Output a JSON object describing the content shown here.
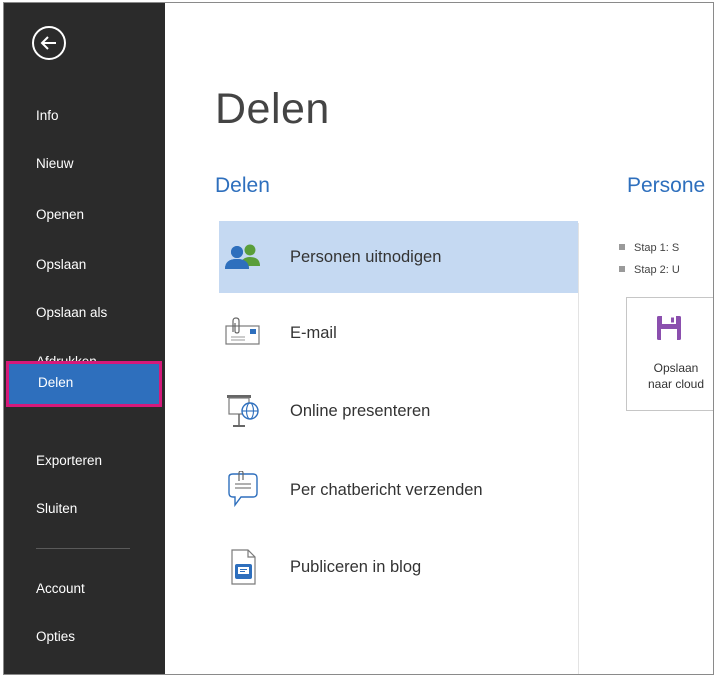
{
  "sidebar": {
    "back_icon": "back-arrow-icon",
    "items": [
      {
        "id": "info",
        "label": "Info"
      },
      {
        "id": "nieuw",
        "label": "Nieuw"
      },
      {
        "id": "openen",
        "label": "Openen"
      },
      {
        "id": "opslaan",
        "label": "Opslaan"
      },
      {
        "id": "opslaan-als",
        "label": "Opslaan als"
      },
      {
        "id": "afdrukken",
        "label": "Afdrukken"
      },
      {
        "id": "delen",
        "label": "Delen",
        "active": true
      },
      {
        "id": "exporteren",
        "label": "Exporteren"
      },
      {
        "id": "sluiten",
        "label": "Sluiten"
      }
    ],
    "bottom_items": [
      {
        "id": "account",
        "label": "Account"
      },
      {
        "id": "opties",
        "label": "Opties"
      }
    ]
  },
  "main": {
    "title": "Delen",
    "section_title": "Delen",
    "options": [
      {
        "label": "Personen uitnodigen",
        "icon": "people-icon",
        "selected": true
      },
      {
        "label": "E-mail",
        "icon": "email-icon"
      },
      {
        "label": "Online presenteren",
        "icon": "presentation-icon"
      },
      {
        "label": "Per chatbericht verzenden",
        "icon": "chat-message-icon"
      },
      {
        "label": "Publiceren in blog",
        "icon": "blog-document-icon"
      }
    ],
    "right_panel": {
      "title": "Persone",
      "steps": [
        "Stap 1: S",
        "Stap 2: U"
      ],
      "save_button": {
        "line1": "Opslaan",
        "line2": "naar cloud",
        "icon": "save-disk-icon"
      }
    }
  },
  "colors": {
    "sidebar_bg": "#2b2b2b",
    "accent_blue": "#2e6fbd",
    "active_outline": "#d6197a",
    "selected_option_bg": "#c5d9f2",
    "save_icon": "#8b4fae"
  }
}
